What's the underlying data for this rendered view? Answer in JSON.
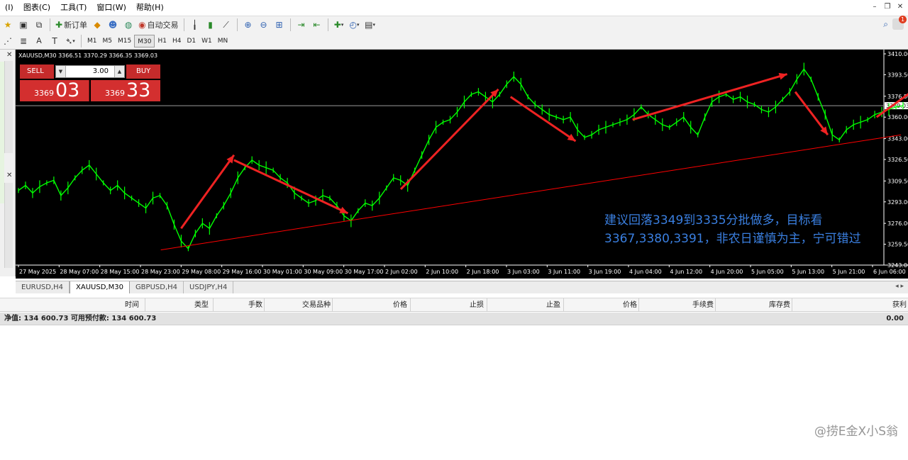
{
  "menu": {
    "items": [
      {
        "label": "(I)"
      },
      {
        "label": "图表(C)"
      },
      {
        "label": "工具(T)"
      },
      {
        "label": "窗口(W)"
      },
      {
        "label": "帮助(H)"
      }
    ]
  },
  "toolbar": {
    "new_order_label": "新订单",
    "auto_trading_label": "自动交易",
    "timeframes": [
      "M1",
      "M5",
      "M15",
      "M30",
      "H1",
      "H4",
      "D1",
      "W1",
      "MN"
    ],
    "active_timeframe": "M30",
    "text_tool_label": "A",
    "notification_count": "1"
  },
  "chart": {
    "header": "XAUUSD,M30  3366.51 3370.29 3366.35 3369.03",
    "background": "#000000",
    "candle_color": "#00ff00",
    "trendline_color": "#ff0000",
    "arrow_color": "#ee2222",
    "trade_panel": {
      "sell_label": "SELL",
      "buy_label": "BUY",
      "lot": "3.00",
      "sell_prefix": "3369",
      "sell_big": "03",
      "buy_prefix": "3369",
      "buy_big": "33"
    },
    "annotation": "建议回落3349到3335分批做多，目标看3367,3380,3391，非农日谨慎为主，宁可错过",
    "current_price_label": "3369.03"
  },
  "chart_data": {
    "type": "line",
    "title": "",
    "symbol": "XAUUSD",
    "timeframe": "M30",
    "xlabel": "",
    "ylabel": "",
    "ylim": [
      3243.0,
      3410.0
    ],
    "y_ticks": [
      "3410.00",
      "3393.50",
      "3376.50",
      "3360.00",
      "3343.00",
      "3326.50",
      "3309.50",
      "3293.00",
      "3276.00",
      "3259.50",
      "3243.00"
    ],
    "x_ticks": [
      "27 May 2025",
      "28 May 07:00",
      "28 May 15:00",
      "28 May 23:00",
      "29 May 08:00",
      "29 May 16:00",
      "30 May 01:00",
      "30 May 09:00",
      "30 May 17:00",
      "2 Jun 02:00",
      "2 Jun 10:00",
      "2 Jun 18:00",
      "3 Jun 03:00",
      "3 Jun 11:00",
      "3 Jun 19:00",
      "4 Jun 04:00",
      "4 Jun 12:00",
      "4 Jun 20:00",
      "5 Jun 05:00",
      "5 Jun 13:00",
      "5 Jun 21:00",
      "6 Jun 06:00"
    ],
    "grid": false,
    "series": [
      {
        "values": [
          3302,
          3306,
          3300,
          3305,
          3308,
          3310,
          3298,
          3304,
          3312,
          3318,
          3322,
          3315,
          3308,
          3302,
          3306,
          3300,
          3296,
          3292,
          3288,
          3296,
          3298,
          3290,
          3275,
          3262,
          3256,
          3268,
          3276,
          3272,
          3282,
          3290,
          3300,
          3312,
          3320,
          3326,
          3322,
          3320,
          3318,
          3312,
          3308,
          3300,
          3296,
          3292,
          3294,
          3298,
          3296,
          3290,
          3282,
          3278,
          3286,
          3292,
          3290,
          3296,
          3304,
          3312,
          3310,
          3306,
          3318,
          3330,
          3342,
          3352,
          3356,
          3358,
          3364,
          3372,
          3378,
          3380,
          3376,
          3372,
          3378,
          3386,
          3392,
          3386,
          3376,
          3370,
          3366,
          3362,
          3360,
          3358,
          3360,
          3350,
          3344,
          3346,
          3350,
          3352,
          3354,
          3356,
          3358,
          3362,
          3368,
          3362,
          3358,
          3354,
          3352,
          3356,
          3360,
          3352,
          3346,
          3360,
          3372,
          3376,
          3378,
          3374,
          3376,
          3372,
          3370,
          3366,
          3364,
          3368,
          3374,
          3380,
          3390,
          3398,
          3390,
          3376,
          3362,
          3346,
          3342,
          3350,
          3354,
          3356,
          3358,
          3362,
          3364,
          3366,
          3368,
          3369
        ]
      }
    ],
    "trendline": {
      "from": [
        3.5,
        3255
      ],
      "to": [
        21.7,
        3346
      ]
    },
    "arrows": [
      {
        "from": [
          4.0,
          3272
        ],
        "to": [
          5.3,
          3330
        ]
      },
      {
        "from": [
          5.3,
          3326
        ],
        "to": [
          8.1,
          3284
        ]
      },
      {
        "from": [
          9.4,
          3303
        ],
        "to": [
          11.8,
          3382
        ]
      },
      {
        "from": [
          12.1,
          3376
        ],
        "to": [
          13.7,
          3341
        ]
      },
      {
        "from": [
          15.1,
          3358
        ],
        "to": [
          18.9,
          3394
        ]
      },
      {
        "from": [
          19.1,
          3380
        ],
        "to": [
          19.9,
          3346
        ]
      },
      {
        "from": [
          21.1,
          3360
        ],
        "to": [
          22.3,
          3388
        ]
      }
    ]
  },
  "symbol_tabs": [
    "EURUSD,H4",
    "XAUUSD,M30",
    "GBPUSD,H4",
    "USDJPY,H4"
  ],
  "active_symbol_tab": "XAUUSD,M30",
  "terminal": {
    "columns": [
      "时间",
      "类型",
      "手数",
      "交易品种",
      "价格",
      "止损",
      "止盈",
      "价格",
      "手续费",
      "库存费",
      "获利"
    ],
    "equity": "净值: 134 600.73  可用预付款: 134 600.73",
    "total": "0.00"
  },
  "watermark": "@捞E金X小S翁"
}
